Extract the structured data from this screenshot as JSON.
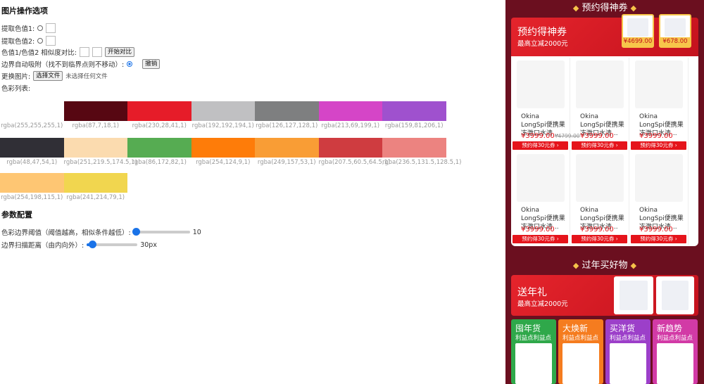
{
  "left": {
    "title": "图片操作选项",
    "pick1_label": "提取色值1:",
    "pick2_label": "提取色值2:",
    "compare_label": "色值1/色值2 相似度对比:",
    "compare_button": "开始对比",
    "edge_label": "边界自动吸附（找不到临界点则不移动）:",
    "undo_button": "撤销",
    "replace_label": "更换图片:",
    "choose_file_button": "选择文件",
    "no_file_text": "未选择任何文件",
    "palette_label": "色彩列表:",
    "swatch_rows": [
      [
        {
          "color": "#ffffff",
          "label": "rgba(255,255,255,1)"
        },
        {
          "color": "#570712",
          "label": "rgba(87,7,18,1)"
        },
        {
          "color": "#e61c29",
          "label": "rgba(230,28,41,1)"
        },
        {
          "color": "#c0c0c2",
          "label": "rgba(192,192,194,1)"
        },
        {
          "color": "#7e7f80",
          "label": "rgba(126,127,128,1)"
        },
        {
          "color": "#d545c7",
          "label": "rgba(213,69,199,1)"
        },
        {
          "color": "#9f51ce",
          "label": "rgba(159,81,206,1)"
        }
      ],
      [
        {
          "color": "#302f36",
          "label": "rgba(48,47,54,1)"
        },
        {
          "color": "#fbdbaf",
          "label": "rgba(251,219.5,174.5,1)"
        },
        {
          "color": "#56ac52",
          "label": "rgba(86,172,82,1)"
        },
        {
          "color": "#fe7c09",
          "label": "rgba(254,124,9,1)"
        },
        {
          "color": "#f99d35",
          "label": "rgba(249,157,53,1)"
        },
        {
          "color": "#cf3c40",
          "label": "rgba(207.5,60.5,64.5,1)"
        },
        {
          "color": "#ec8380",
          "label": "rgba(236.5,131.5,128.5,1)"
        }
      ],
      [
        {
          "color": "#fec673",
          "label": "rgba(254,198,115,1)"
        },
        {
          "color": "#f1d64f",
          "label": "rgba(241,214,79,1)"
        }
      ]
    ],
    "params_title": "参数配置",
    "threshold_label": "色彩边界阈值（阈值越高，相似条件越低）:",
    "threshold_value": "10",
    "threshold_fraction": 0.02,
    "distance_label": "边界扫描距离（由内向外）:",
    "distance_value": "30px",
    "distance_fraction": 0.08
  },
  "right": {
    "section1_title": "预约得神券",
    "banner1_title": "预约得神券",
    "banner1_sub": "最高立减2000元",
    "banner_prices": [
      "¥4699.00",
      "¥678.00"
    ],
    "products": [
      {
        "name": "Okina LongSpi便携果冻激口水清...",
        "price": "¥3999.00",
        "old": "¥4799.00",
        "coupon": "预约得30元券"
      },
      {
        "name": "Okina LongSpi便携果冻激口水清...",
        "price": "¥3999.00",
        "old": "",
        "coupon": "预约得30元券"
      },
      {
        "name": "Okina LongSpi便携果冻激口水清...",
        "price": "¥3999.00",
        "old": "",
        "coupon": "预约得30元券"
      },
      {
        "name": "Okina LongSpi便携果冻激口水清...",
        "price": "¥3999.00",
        "old": "",
        "coupon": "预约得30元券"
      },
      {
        "name": "Okina LongSpi便携果冻激口水清...",
        "price": "¥3999.00",
        "old": "",
        "coupon": "预约得30元券"
      },
      {
        "name": "Okina LongSpi便携果冻激口水清...",
        "price": "¥3999.00",
        "old": "",
        "coupon": "预约得30元券"
      }
    ],
    "section2_title": "过年买好物",
    "banner2_title": "送年礼",
    "banner2_sub": "最高立减2000元",
    "categories": [
      {
        "title": "囤年货",
        "sub": "利益点利益点",
        "color": "#2fa84a"
      },
      {
        "title": "大焕新",
        "sub": "利益点利益点",
        "color": "#f57c1f"
      },
      {
        "title": "买洋货",
        "sub": "利益点利益点",
        "color": "#9c3fc9"
      },
      {
        "title": "新趋势",
        "sub": "利益点利益点",
        "color": "#d23aa6"
      }
    ]
  }
}
